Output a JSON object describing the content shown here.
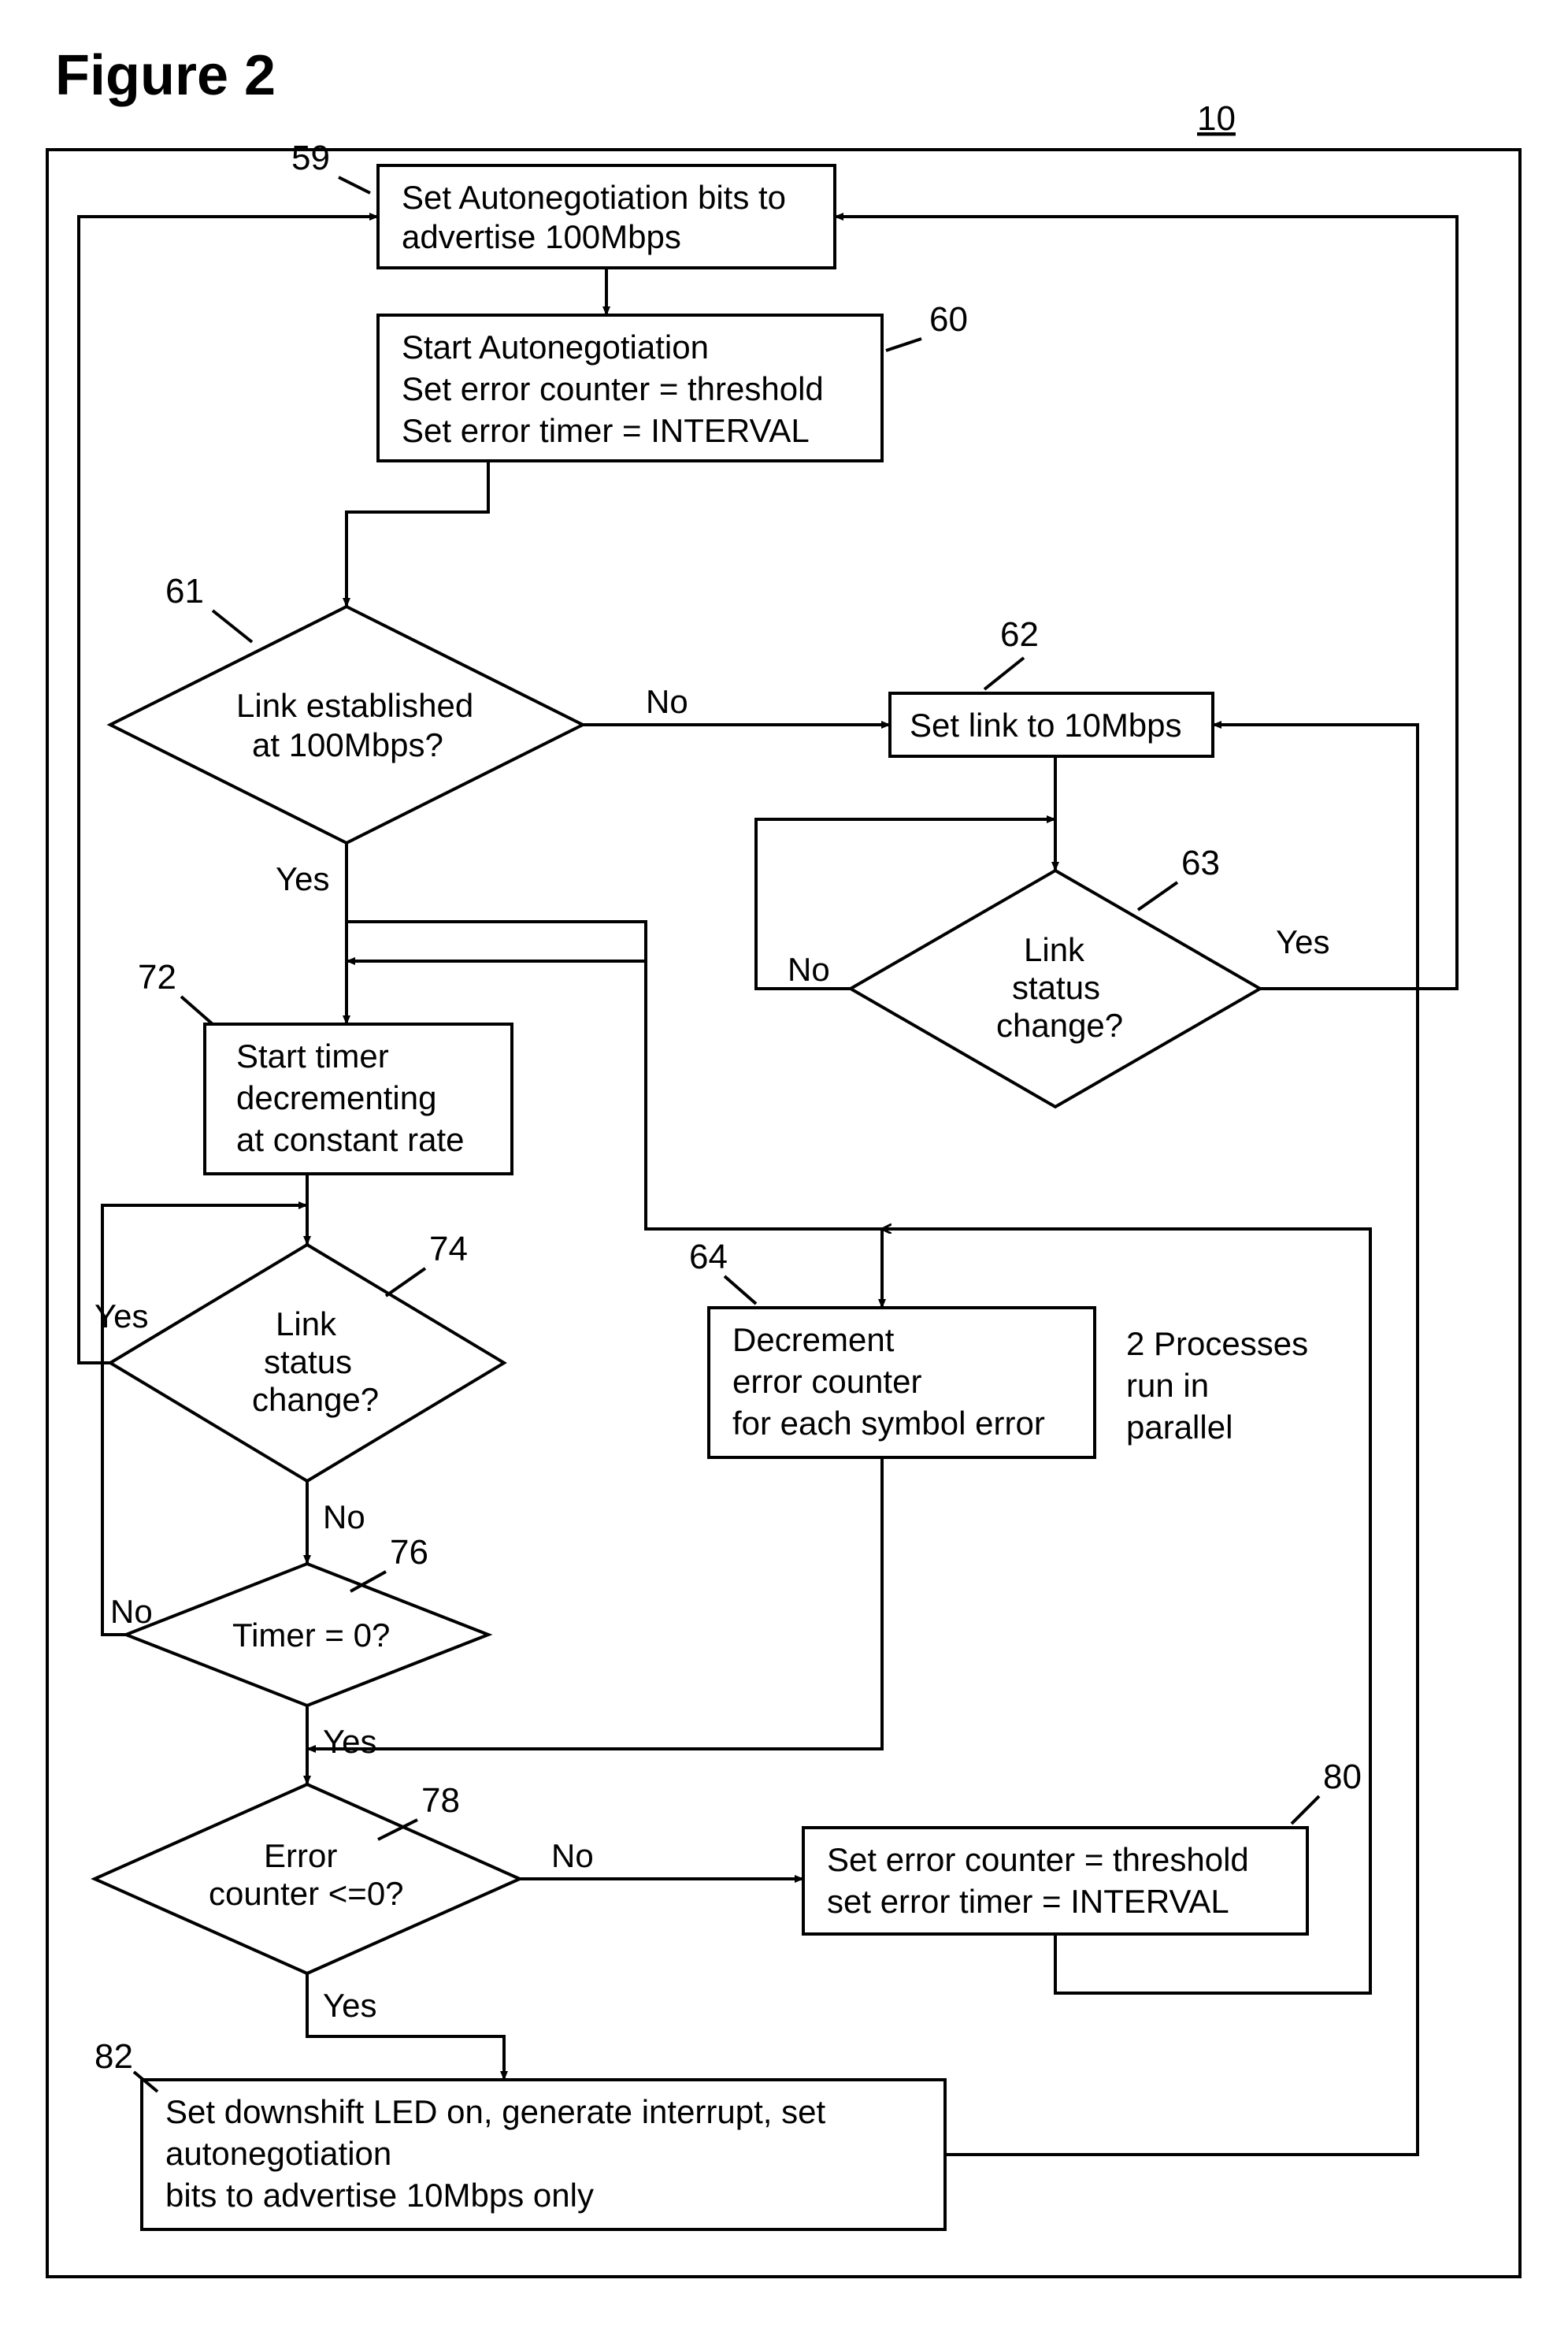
{
  "title": "Figure 2",
  "page_ref": "10",
  "nodes": {
    "n59": {
      "ref": "59",
      "lines": [
        "Set Autonegotiation bits to",
        "advertise 100Mbps"
      ]
    },
    "n60": {
      "ref": "60",
      "lines": [
        "Start Autonegotiation",
        "Set error counter = threshold",
        "Set error timer = INTERVAL"
      ]
    },
    "n61": {
      "ref": "61",
      "lines": [
        "Link established",
        "at 100Mbps?"
      ]
    },
    "n62": {
      "ref": "62",
      "lines": [
        "Set link to 10Mbps"
      ]
    },
    "n63": {
      "ref": "63",
      "lines": [
        "Link",
        "status",
        "change?"
      ]
    },
    "n72": {
      "ref": "72",
      "lines": [
        "Start timer",
        "decrementing",
        "at constant rate"
      ]
    },
    "n74": {
      "ref": "74",
      "lines": [
        "Link",
        "status",
        "change?"
      ]
    },
    "n76": {
      "ref": "76",
      "lines": [
        "Timer = 0?"
      ]
    },
    "n64": {
      "ref": "64",
      "lines": [
        "Decrement",
        "error counter",
        "for each symbol error"
      ]
    },
    "n78": {
      "ref": "78",
      "lines": [
        "Error",
        "counter <=0?"
      ]
    },
    "n80": {
      "ref": "80",
      "lines": [
        "Set error counter = threshold",
        "set error timer = INTERVAL"
      ]
    },
    "n82": {
      "ref": "82",
      "lines": [
        "Set downshift LED on, generate interrupt, set",
        "autonegotiation",
        "bits to advertise 10Mbps only"
      ]
    }
  },
  "labels": {
    "yes": "Yes",
    "no": "No"
  },
  "note_parallel": [
    "2 Processes",
    "run in",
    "parallel"
  ]
}
